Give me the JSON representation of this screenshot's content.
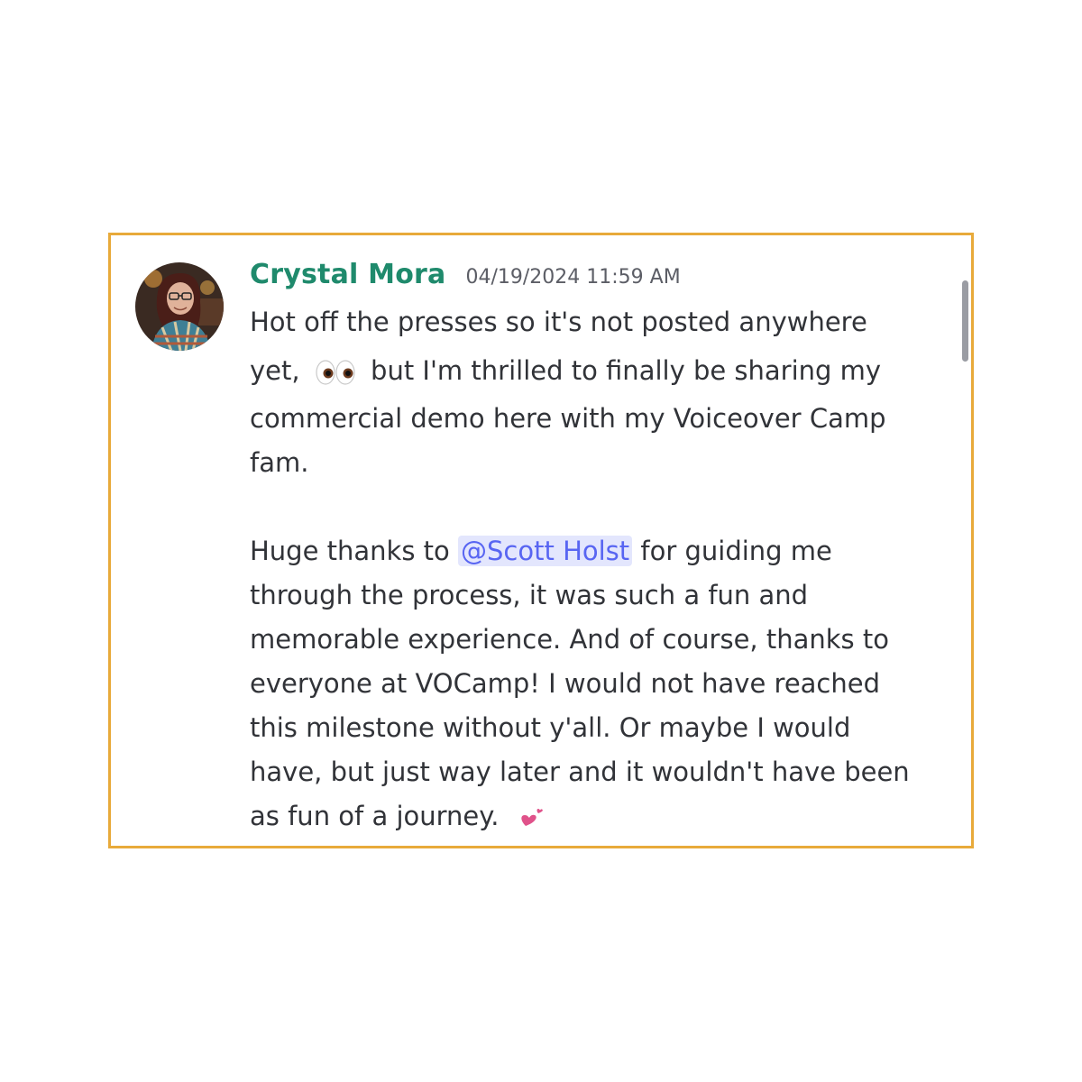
{
  "message": {
    "author": "Crystal Mora",
    "timestamp": "04/19/2024 11:59 AM",
    "author_color": "#1f8a6c",
    "frame_color": "#e8aa3a",
    "avatar_icon": "user-avatar-photo",
    "paragraph1": {
      "line1": "Hot off the presses so it's not posted anywhere",
      "line2_before_emoji": "yet,",
      "emoji1": "eyes-emoji",
      "line2_after_emoji": "but I'm thrilled to finally be sharing my",
      "line3": "commercial demo here with my Voiceover Camp",
      "line4": "fam."
    },
    "paragraph2": {
      "line1_before_mention": "Huge thanks to",
      "mention": "@Scott Holst",
      "mention_color": "#5865f2",
      "line1_after_mention": "for guiding me",
      "line2": "through the process, it was such a fun and",
      "line3": "memorable experience. And of course, thanks to",
      "line4": "everyone at VOCamp! I would not have reached",
      "line5": "this milestone without y'all. Or maybe I would",
      "line6": "have, but just way later and it wouldn't have been",
      "line7": "as fun of a journey.",
      "emoji2": "two-hearts-emoji"
    }
  }
}
